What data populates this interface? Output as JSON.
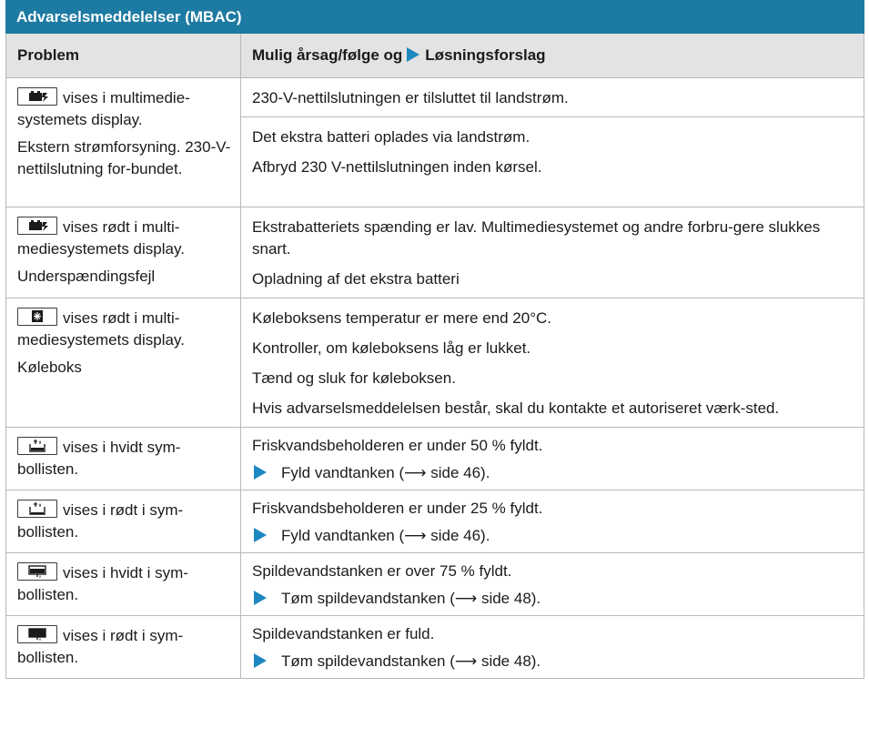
{
  "title": "Advarselsmeddelelser (MBAC)",
  "header": {
    "problem": "Problem",
    "solution_part1": "Mulig årsag/følge og",
    "solution_part2": "Løsningsforslag"
  },
  "rows": [
    {
      "icon": "battery-plug-icon",
      "problem": [
        "vises i multimedie-systemets display.",
        "Ekstern strømforsyning. 230-V-nettilslutning for-bundet."
      ],
      "solutions": [
        [
          "230-V-nettilslutningen er tilsluttet til landstrøm."
        ],
        [
          "Det ekstra batteri oplades via landstrøm.",
          "Afbryd 230 V-nettilslutningen inden kørsel."
        ]
      ]
    },
    {
      "icon": "battery-plug-icon",
      "problem": [
        "vises rødt i multi-mediesystemets display.",
        "Underspændingsfejl"
      ],
      "solutions": [
        "Ekstrabatteriets spænding er lav. Multimediesystemet og andre forbru-gere slukkes snart.",
        "Opladning af det ekstra batteri"
      ]
    },
    {
      "icon": "cooler-box-icon",
      "problem": [
        "vises rødt i multi-mediesystemets display.",
        "Køleboks"
      ],
      "solutions": [
        "Køleboksens temperatur er mere end 20°C.",
        "Kontroller, om køleboksens låg er lukket.",
        "Tænd og sluk for køleboksen.",
        "Hvis advarselsmeddelelsen består, skal du kontakte et autoriseret værk-sted."
      ]
    },
    {
      "icon": "fresh-water-tank-icon",
      "problem": [
        "vises i hvidt sym-bollisten."
      ],
      "solutions": [
        "Friskvandsbeholderen er under 50 % fyldt.",
        "Fyld vandtanken (⟶ side 46)."
      ]
    },
    {
      "icon": "fresh-water-tank-icon",
      "problem": [
        "vises i rødt i sym-bollisten."
      ],
      "solutions": [
        "Friskvandsbeholderen er under 25 % fyldt.",
        "Fyld vandtanken (⟶ side 46)."
      ]
    },
    {
      "icon": "waste-water-tank-icon",
      "problem": [
        "vises i hvidt i sym-bollisten."
      ],
      "solutions": [
        "Spildevandstanken er over 75 % fyldt.",
        "Tøm spildevandstanken (⟶ side 48)."
      ]
    },
    {
      "icon": "waste-water-tank-icon",
      "problem": [
        "vises i rødt i sym-bollisten."
      ],
      "solutions": [
        "Spildevandstanken er fuld.",
        "Tøm spildevandstanken (⟶ side 48)."
      ]
    }
  ],
  "colors": {
    "title_bg": "#1d7aa2",
    "header_bg": "#e3e3e3",
    "step_arrow": "#1d88c0"
  }
}
